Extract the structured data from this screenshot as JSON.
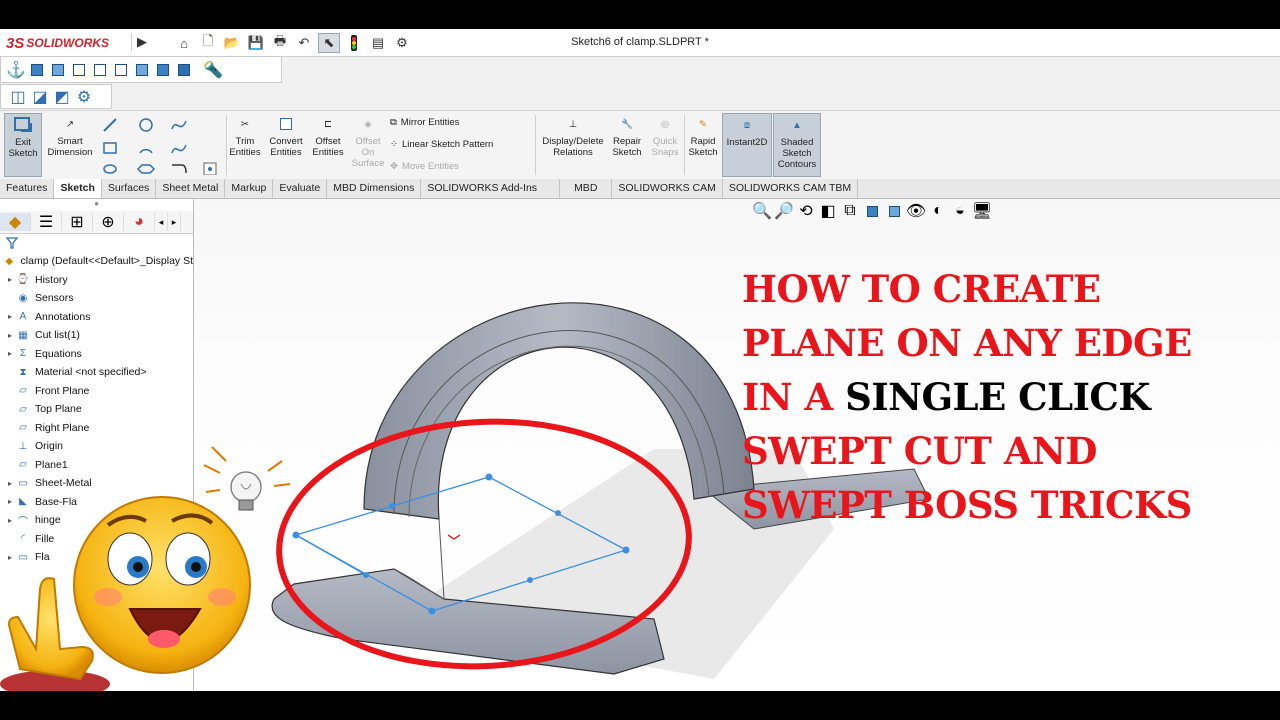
{
  "app": {
    "logo_ds": "3S",
    "logo_text": "SOLIDWORKS",
    "doc_title": "Sketch6 of clamp.SLDPRT *"
  },
  "ribbon": {
    "exit_sketch": "Exit Sketch",
    "smart_dimension": "Smart Dimension",
    "trim_entities": "Trim Entities",
    "convert_entities": "Convert Entities",
    "offset_entities": "Offset Entities",
    "offset_on_surface": "Offset On Surface",
    "mirror_entities": "Mirror Entities",
    "linear_sketch_pattern": "Linear Sketch Pattern",
    "move_entities": "Move Entities",
    "display_delete_relations": "Display/Delete Relations",
    "repair_sketch": "Repair Sketch",
    "quick_snaps": "Quick Snaps",
    "rapid_sketch": "Rapid Sketch",
    "instant2d": "Instant2D",
    "shaded_sketch_contours": "Shaded Sketch Contours"
  },
  "tabs": [
    {
      "label": "Features"
    },
    {
      "label": "Sketch"
    },
    {
      "label": "Surfaces"
    },
    {
      "label": "Sheet Metal"
    },
    {
      "label": "Markup"
    },
    {
      "label": "Evaluate"
    },
    {
      "label": "MBD Dimensions"
    },
    {
      "label": "SOLIDWORKS Add-Ins"
    },
    {
      "label": "MBD"
    },
    {
      "label": "SOLIDWORKS CAM"
    },
    {
      "label": "SOLIDWORKS CAM TBM"
    }
  ],
  "tree": {
    "root": "clamp  (Default<<Default>_Display St",
    "items": [
      {
        "label": "History",
        "icon": "history-icon",
        "arrow": "▸"
      },
      {
        "label": "Sensors",
        "icon": "sensors-icon",
        "arrow": ""
      },
      {
        "label": "Annotations",
        "icon": "annotations-icon",
        "arrow": "▸"
      },
      {
        "label": "Cut list(1)",
        "icon": "cut-list-icon",
        "arrow": "▸"
      },
      {
        "label": "Equations",
        "icon": "equations-icon",
        "arrow": "▸"
      },
      {
        "label": "Material <not specified>",
        "icon": "material-icon",
        "arrow": ""
      },
      {
        "label": "Front Plane",
        "icon": "plane-icon",
        "arrow": ""
      },
      {
        "label": "Top Plane",
        "icon": "plane-icon",
        "arrow": ""
      },
      {
        "label": "Right Plane",
        "icon": "plane-icon",
        "arrow": ""
      },
      {
        "label": "Origin",
        "icon": "origin-icon",
        "arrow": ""
      },
      {
        "label": "Plane1",
        "icon": "plane-icon",
        "arrow": ""
      },
      {
        "label": "Sheet-Metal",
        "icon": "sheet-metal-icon",
        "arrow": "▸"
      },
      {
        "label": "Base-Fla",
        "icon": "base-flange-icon",
        "arrow": "▸"
      },
      {
        "label": "hinge",
        "icon": "hinge-icon",
        "arrow": "▸"
      },
      {
        "label": "Fille",
        "icon": "fillet-icon",
        "arrow": ""
      },
      {
        "label": "Fla",
        "icon": "flat-pattern-icon",
        "arrow": "▸"
      }
    ]
  },
  "headline": {
    "line1": "HOW TO CREATE",
    "line2": "PLANE ON ANY EDGE",
    "line3_red": "IN A ",
    "line3_black": "SINGLE CLICK",
    "line4": "SWEPT CUT AND",
    "line5": "SWEPT BOSS TRICKS"
  },
  "colors": {
    "accent_red": "#e8151b",
    "sketch_blue": "#3d8fe0",
    "model_gray": "#9aa0ad"
  }
}
